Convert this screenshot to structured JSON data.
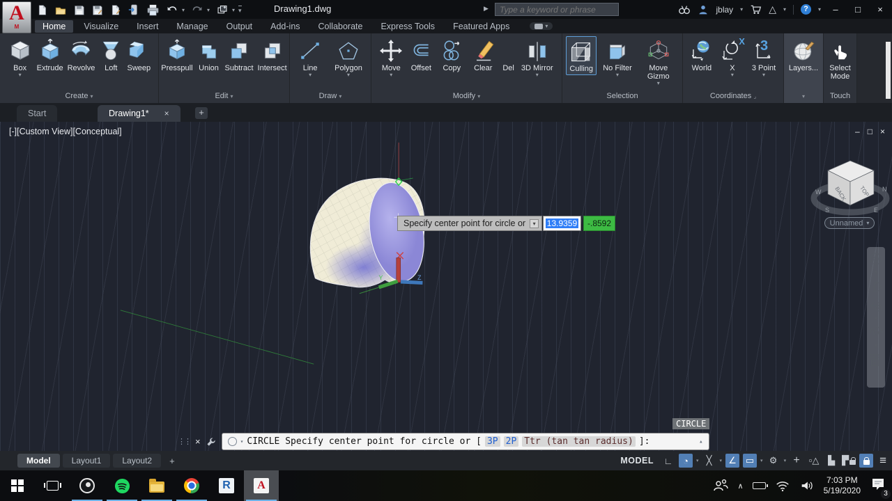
{
  "colors": {
    "accent_blue": "#527fb5",
    "selection_green": "#3dbb43",
    "command_blue": "#1f5fd0",
    "autocad_red": "#c00f1e"
  },
  "icons": {
    "caret": "▾",
    "caret_up": "▴",
    "minimize": "–",
    "maximize": "□",
    "close": "×",
    "plus": "+",
    "hamburger": "≡",
    "help": "?",
    "app_triangle": "△",
    "expand_right": "▶",
    "launcher": "⌟",
    "corner": "∟",
    "snap_circle": "◔",
    "isodraft": "╳",
    "angle": "∠",
    "osnap_rect": "▭",
    "gear": "⚙",
    "crosshair": "+",
    "objects": "▫△",
    "ws_blocks": "▙",
    "ws_blocks2": "▛",
    "dots_handle": "⋮⋮",
    "chevron_up": "∧",
    "acad_letter": "A",
    "acad_sub": "M",
    "revit_letter": "R",
    "three": "3",
    "x_axis": "X"
  },
  "title_bar": {
    "title": "Drawing1.dwg",
    "search_placeholder": "Type a keyword or phrase",
    "user_name": "jblay"
  },
  "ribbon": {
    "tabs": [
      "Home",
      "Visualize",
      "Insert",
      "Manage",
      "Output",
      "Add-ins",
      "Collaborate",
      "Express Tools",
      "Featured Apps"
    ],
    "active_tab": "Home",
    "panels": [
      {
        "label": "Create",
        "buttons": [
          "Box",
          "Extrude",
          "Revolve",
          "Loft",
          "Sweep"
        ]
      },
      {
        "label": "Edit",
        "buttons": [
          "Presspull",
          "Union",
          "Subtract",
          "Intersect"
        ]
      },
      {
        "label": "Draw",
        "buttons": [
          "Line",
          "Polygon"
        ]
      },
      {
        "label": "Modify",
        "buttons": [
          "Move",
          "Offset",
          "Copy",
          "Clear",
          "Del",
          "3D Mirror"
        ]
      },
      {
        "label": "Selection",
        "buttons": [
          "Culling",
          "No Filter",
          "Move Gizmo"
        ]
      },
      {
        "label": "Coordinates",
        "buttons": [
          "World",
          "X",
          "3 Point"
        ]
      },
      {
        "label": "",
        "buttons": [
          "Layers..."
        ]
      },
      {
        "label": "Touch",
        "buttons": [
          "Select Mode"
        ]
      }
    ]
  },
  "file_tabs": {
    "tabs": [
      "Start",
      "Drawing1*"
    ],
    "new_label": "+"
  },
  "viewport": {
    "label": "[-][Custom View][Conceptual]",
    "named_view": "Unnamed",
    "tooltip": "Specify center point for circle or",
    "coord_x": "13.9359",
    "coord_y": "-.8592",
    "command_badge": "CIRCLE",
    "axis_y": "Y",
    "axis_z": "Z",
    "viewcube": {
      "back": "BACK",
      "top": "TOP",
      "n": "N",
      "s": "S",
      "e": "E",
      "w": "W"
    }
  },
  "command_line": {
    "prefix": "CIRCLE Specify center point for circle or [",
    "opt_3p": "3P",
    "opt_2p": "2P",
    "opt_ttr": "Ttr (tan tan radius)",
    "suffix": "]:"
  },
  "layout_tabs": {
    "tabs": [
      "Model",
      "Layout1",
      "Layout2"
    ],
    "new_label": "+"
  },
  "status_bar": {
    "model_label": "MODEL"
  },
  "taskbar": {
    "time": "7:03 PM",
    "date": "5/19/2020",
    "notification_count": "3"
  }
}
